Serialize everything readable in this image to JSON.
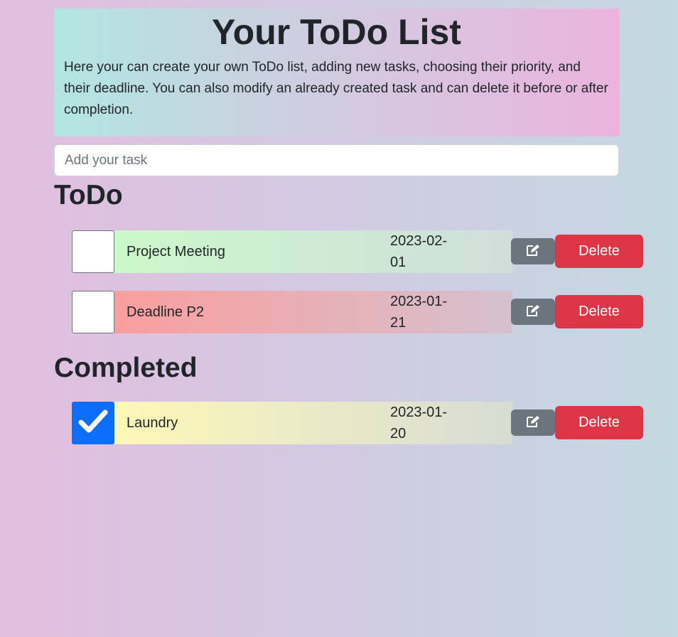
{
  "header": {
    "title": "Your ToDo List",
    "description": "Here your can create your own ToDo list, adding new tasks, choosing their priority, and their deadline. You can also modify an already created task and can delete it before or after completion."
  },
  "input": {
    "placeholder": "Add your task",
    "value": ""
  },
  "sections": {
    "todo_title": "ToDo",
    "completed_title": "Completed"
  },
  "todo_tasks": [
    {
      "name": "Project Meeting",
      "date": "2023-02-01",
      "checked": false,
      "gradient_from": "#cbf8cb",
      "gradient_to": "#d0dedb",
      "delete_label": "Delete",
      "edit_icon": "edit-icon"
    },
    {
      "name": "Deadline P2",
      "date": "2023-01-21",
      "checked": false,
      "gradient_from": "#fa9e9e",
      "gradient_to": "#d5c1ce",
      "delete_label": "Delete",
      "edit_icon": "edit-icon"
    }
  ],
  "completed_tasks": [
    {
      "name": "Laundry",
      "date": "2023-01-20",
      "checked": true,
      "gradient_from": "#fdf8b8",
      "gradient_to": "#d8dcd4",
      "delete_label": "Delete",
      "edit_icon": "edit-icon"
    }
  ],
  "colors": {
    "checkbox_checked": "#0d6efd",
    "edit_button": "#6c757d",
    "delete_button": "#dc3545"
  }
}
